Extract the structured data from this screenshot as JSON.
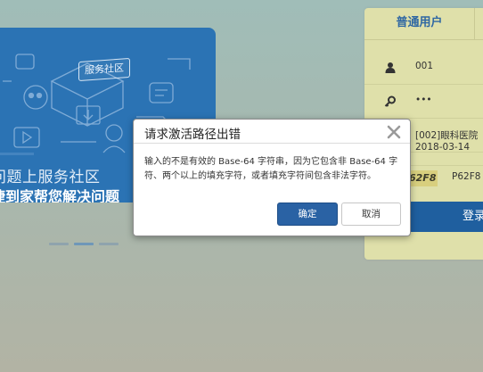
{
  "banner": {
    "badge": "服务社区",
    "line1": "问题上服务社区",
    "line2": "捷到家帮您解决问题",
    "slides_total": 3,
    "slide_active": 2
  },
  "login": {
    "tab_label": "普通用户",
    "username": "001",
    "password_mask": "•••",
    "organization": "[002]眼科医院",
    "date": "2018-03-14",
    "captcha_image_text": "62F8",
    "captcha_value": "P62F8",
    "login_label": "登录"
  },
  "dialog": {
    "title": "请求激活路径出错",
    "message": "输入的不是有效的 Base-64 字符串，因为它包含非 Base-64 字符、两个以上的填充字符，或者填充字符间包含非法字符。",
    "ok_label": "确定",
    "cancel_label": "取消"
  },
  "colors": {
    "banner_bg": "#2b73b4",
    "panel_bg": "#dfe0aa",
    "primary_button": "#2a62a4",
    "tab_text": "#2f67a3"
  },
  "icons": {
    "user_row": "user-icon",
    "password_row": "key-icon",
    "org_row": "building-icon",
    "date_row": "calendar-icon",
    "close": "close-icon"
  }
}
